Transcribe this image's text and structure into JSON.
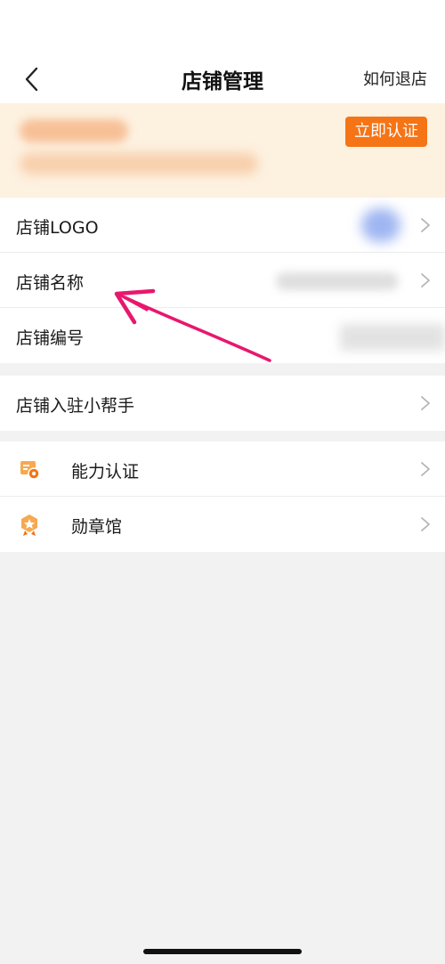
{
  "header": {
    "title": "店铺管理",
    "exit_link": "如何退店",
    "back_icon": "chevron-left-icon"
  },
  "banner": {
    "certify_button": "立即认证",
    "accent_color": "#f57415",
    "background_color": "#fdf1e0"
  },
  "shop_info": {
    "items": [
      {
        "label": "店铺LOGO"
      },
      {
        "label": "店铺名称"
      },
      {
        "label": "店铺编号"
      }
    ]
  },
  "helper": {
    "items": [
      {
        "label": "店铺入驻小帮手"
      }
    ]
  },
  "more": {
    "items": [
      {
        "label": "能力认证",
        "icon": "certificate-icon"
      },
      {
        "label": "勋章馆",
        "icon": "medal-icon"
      }
    ]
  },
  "annotation_color": "#e8176e"
}
